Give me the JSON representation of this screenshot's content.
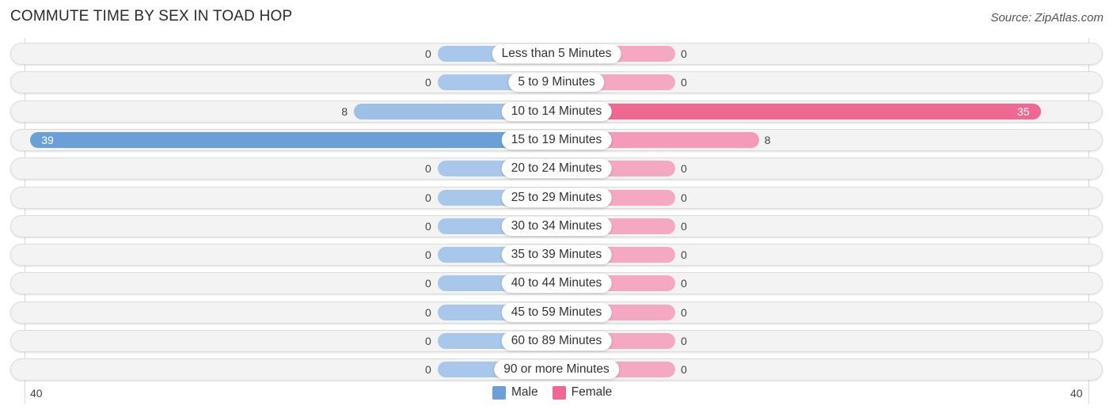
{
  "title": "COMMUTE TIME BY SEX IN TOAD HOP",
  "source": "Source: ZipAtlas.com",
  "colors": {
    "male": "#6a9fd8",
    "male_light": "#a9c7ea",
    "female": "#f06891",
    "female_light": "#f5a8c1"
  },
  "chart_data": {
    "type": "bar",
    "orientation": "horizontal-diverging",
    "title": "COMMUTE TIME BY SEX IN TOAD HOP",
    "categories": [
      "Less than 5 Minutes",
      "5 to 9 Minutes",
      "10 to 14 Minutes",
      "15 to 19 Minutes",
      "20 to 24 Minutes",
      "25 to 29 Minutes",
      "30 to 34 Minutes",
      "35 to 39 Minutes",
      "40 to 44 Minutes",
      "45 to 59 Minutes",
      "60 to 89 Minutes",
      "90 or more Minutes"
    ],
    "series": [
      {
        "name": "Male",
        "values": [
          0,
          0,
          8,
          39,
          0,
          0,
          0,
          0,
          0,
          0,
          0,
          0
        ]
      },
      {
        "name": "Female",
        "values": [
          0,
          0,
          35,
          8,
          0,
          0,
          0,
          0,
          0,
          0,
          0,
          0
        ]
      }
    ],
    "axis": {
      "left_tick": "40",
      "right_tick": "40",
      "range": [
        40,
        40
      ]
    },
    "legend": {
      "position": "bottom-center",
      "entries": [
        "Male",
        "Female"
      ]
    }
  }
}
